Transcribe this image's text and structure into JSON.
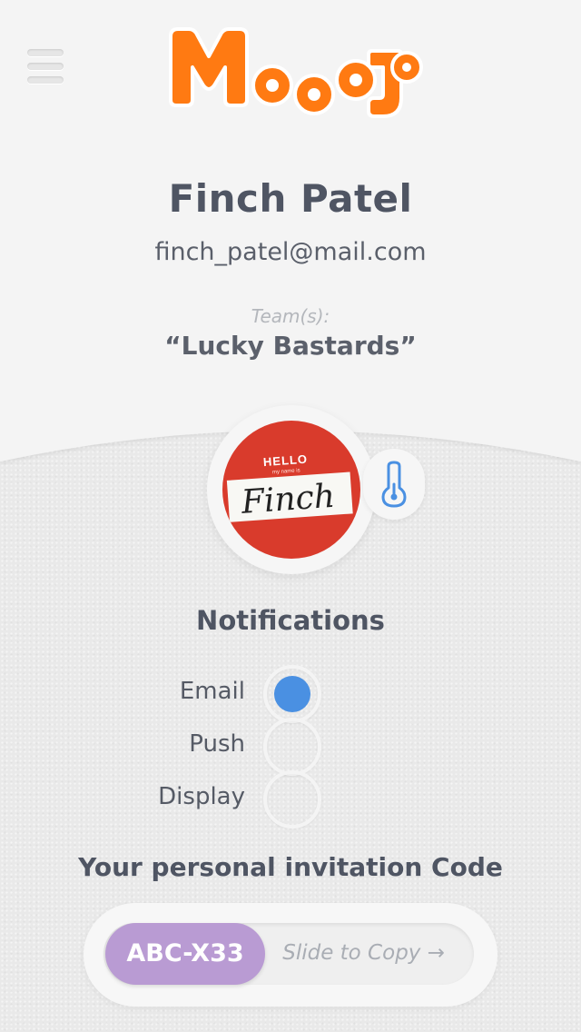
{
  "header": {
    "menu_icon": "hamburger-menu-icon",
    "logo_text": "Mooojo"
  },
  "profile": {
    "name": "Finch Patel",
    "email": "finch_patel@mail.com",
    "teams_label": "Team(s):",
    "team_name": "“Lucky Bastards”",
    "avatar": {
      "hello_text": "HELLO",
      "subtext": "my name is",
      "name_text": "Finch"
    },
    "thermometer_icon": "thermometer-icon"
  },
  "notifications": {
    "title": "Notifications",
    "options": [
      {
        "label": "Email",
        "checked": true
      },
      {
        "label": "Push",
        "checked": false
      },
      {
        "label": "Display",
        "checked": false
      }
    ]
  },
  "invitation": {
    "title": "Your personal invitation Code",
    "code": "ABC-X33",
    "hint": "Slide to Copy →"
  },
  "colors": {
    "logo_orange": "#ff7a12",
    "accent_blue": "#4a90e2",
    "code_purple": "#b99bd3",
    "avatar_red": "#d93b2c",
    "text_dark": "#4f5563"
  }
}
